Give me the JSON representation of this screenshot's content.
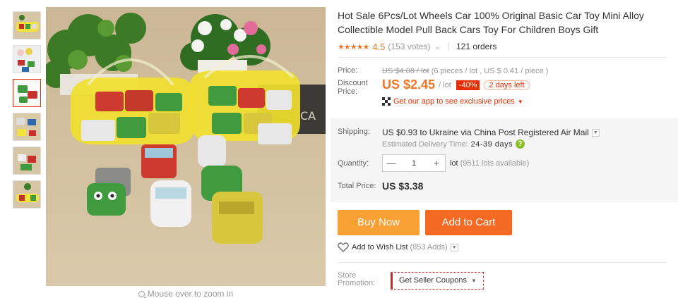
{
  "gallery": {
    "thumbnail_count": 6,
    "zoom_hint": "Mouse over to zoom in"
  },
  "product": {
    "title": "Hot Sale 6Pcs/Lot Wheels Car 100% Original Basic Car Toy Mini Alloy Collectible Model Pull Back Cars Toy For Children Boys Gift",
    "stars": "★★★★★",
    "rating": "4.5",
    "votes": "(153 votes)",
    "orders": "121 orders"
  },
  "price": {
    "label": "Price:",
    "original": "US $4.08 / lot",
    "original_note": "(6 pieces / lot , US $ 0.41 / piece )",
    "discount_label": "Discount Price:",
    "discount_value": "US $2.45",
    "discount_unit": "/ lot",
    "discount_badge": "-40%",
    "days_left": "2 days left",
    "app_promo": "Get our app to see exclusive prices"
  },
  "shipping": {
    "label": "Shipping:",
    "value": "US $0.93 to Ukraine via China Post Registered Air Mail",
    "delivery_label": "Estimated Delivery Time:",
    "delivery_days": "24-39 days",
    "help": "?"
  },
  "quantity": {
    "label": "Quantity:",
    "minus": "—",
    "value": "1",
    "plus": "+",
    "unit": "lot",
    "available": "(9511 lots available)"
  },
  "total": {
    "label": "Total Price:",
    "value": "US $3.38"
  },
  "actions": {
    "buy_now": "Buy Now",
    "add_to_cart": "Add to Cart",
    "wish_label": "Add to Wish List",
    "wish_count": "(853 Adds)"
  },
  "store": {
    "label": "Store Promotion:",
    "coupon": "Get Seller Coupons"
  },
  "colors": {
    "accent_orange": "#f0772a",
    "buy_now_bg": "#f8a033",
    "add_to_cart_bg": "#f46a23",
    "discount_red": "#e62e04",
    "help_green": "#8cbf26"
  }
}
